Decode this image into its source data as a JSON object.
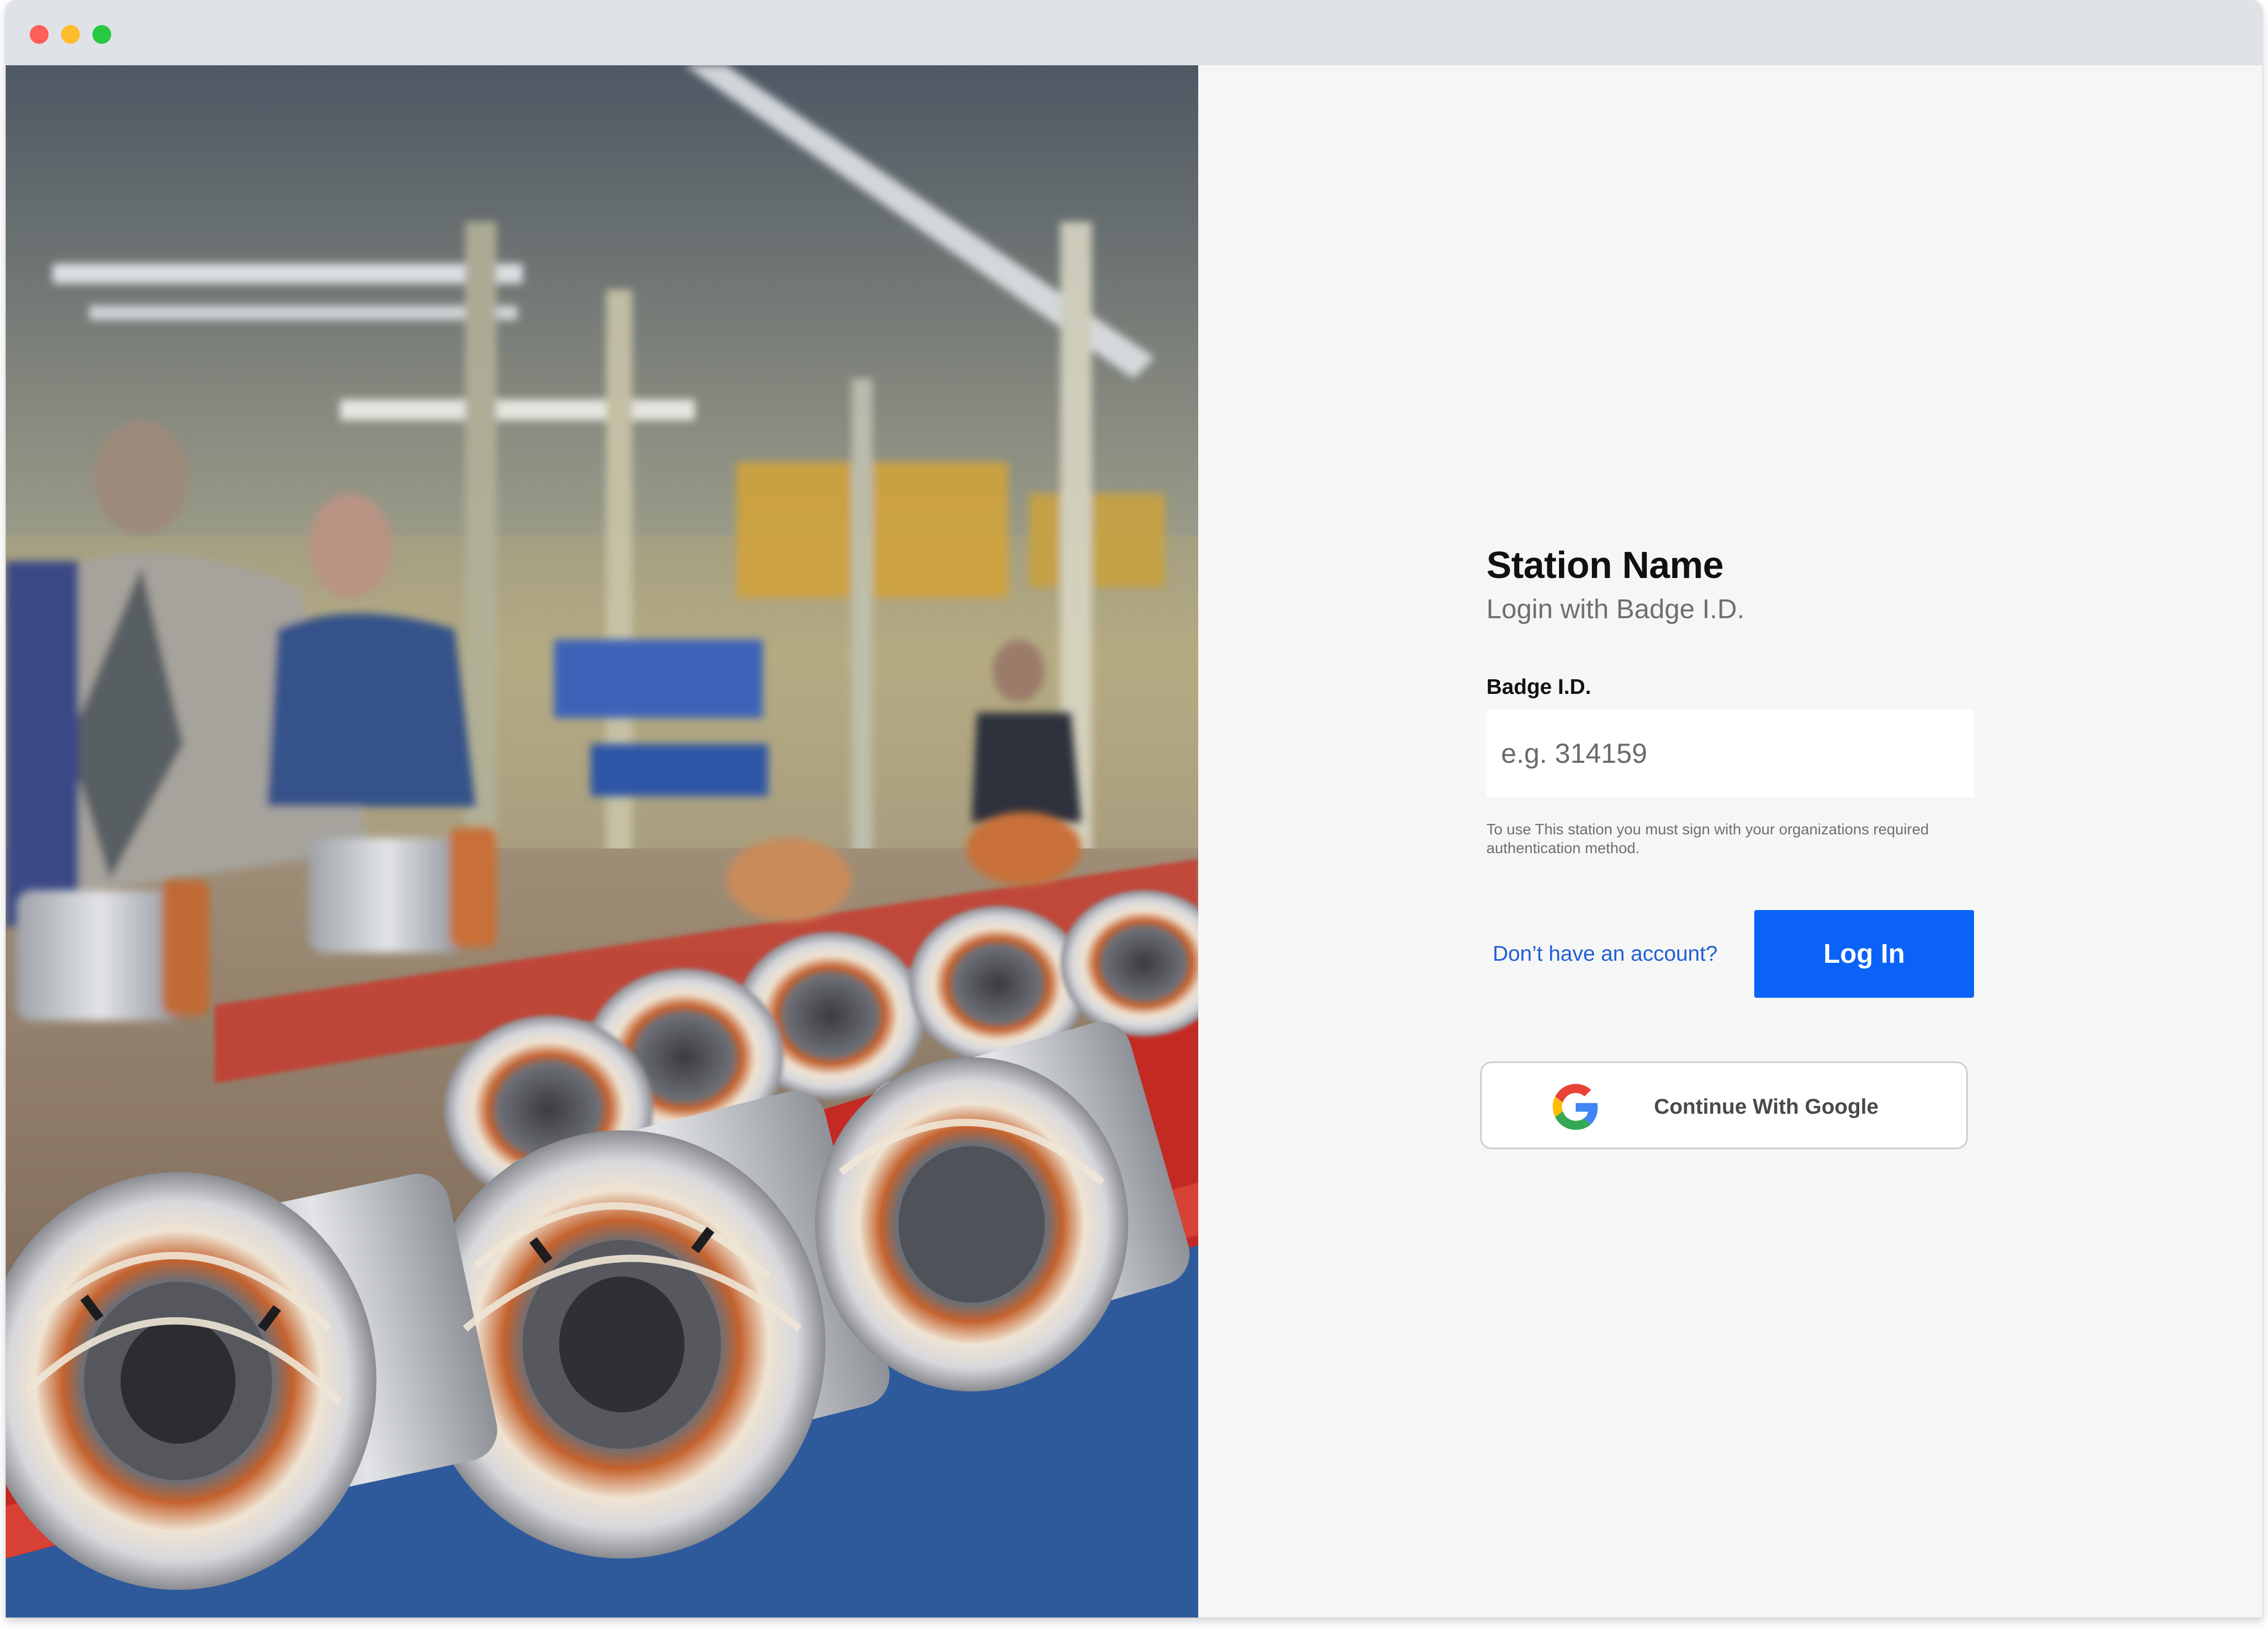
{
  "login": {
    "title": "Station Name",
    "subtitle": "Login with Badge I.D.",
    "badge_label": "Badge I.D.",
    "badge_placeholder": "e.g. 314159",
    "badge_value": "",
    "hint": "To use This station you must sign with your organizations required authentication method.",
    "signup_link": "Don’t have an account?",
    "login_button": "Log In",
    "google_button": "Continue With Google"
  },
  "colors": {
    "accent": "#0a63f6",
    "link": "#1f5fd6",
    "panel_background": "#f6f6f6",
    "titlebar": "#dfe2e7"
  },
  "icons": {
    "window_controls": [
      "close-dot",
      "minimize-dot",
      "maximize-dot"
    ],
    "google": "google-icon"
  }
}
